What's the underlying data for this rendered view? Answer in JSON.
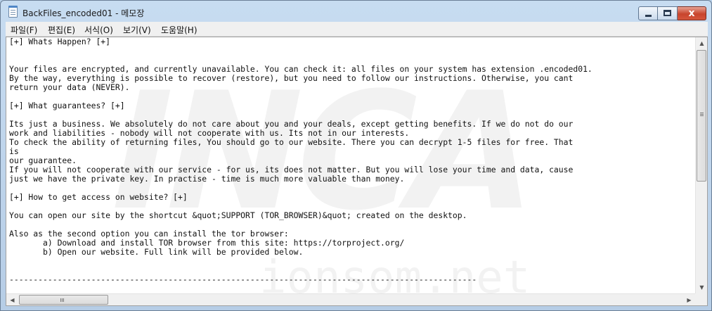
{
  "window": {
    "title": "BackFiles_encoded01 - 메모장",
    "icon": "notepad-icon"
  },
  "controls": {
    "minimize": "minimize-icon",
    "maximize": "maximize-icon",
    "close_glyph": "x"
  },
  "menu": {
    "items": [
      {
        "label": "파일(F)"
      },
      {
        "label": "편집(E)"
      },
      {
        "label": "서식(O)"
      },
      {
        "label": "보기(V)"
      },
      {
        "label": "도움말(H)"
      }
    ]
  },
  "document": {
    "text": "[+] Whats Happen? [+]\n\n\nYour files are encrypted, and currently unavailable. You can check it: all files on your system has extension .encoded01.\nBy the way, everything is possible to recover (restore), but you need to follow our instructions. Otherwise, you cant\nreturn your data (NEVER).\n\n[+] What guarantees? [+]\n\nIts just a business. We absolutely do not care about you and your deals, except getting benefits. If we do not do our\nwork and liabilities - nobody will not cooperate with us. Its not in our interests.\nTo check the ability of returning files, You should go to our website. There you can decrypt 1-5 files for free. That\nis\nour guarantee.\nIf you will not cooperate with our service - for us, its does not matter. But you will lose your time and data, cause\njust we have the private key. In practise - time is much more valuable than money.\n\n[+] How to get access on website? [+]\n\nYou can open our site by the shortcut &quot;SUPPORT (TOR_BROWSER)&quot; created on the desktop.\n\nAlso as the second option you can install the tor browser:\n       a) Download and install TOR browser from this site: https://torproject.org/\n       b) Open our website. Full link will be provided below.\n\n\n-------------------------------------------------------------------------------------------------"
  },
  "scrollbars": {
    "vertical": {
      "up": "▲",
      "down": "▼",
      "position": 0.0
    },
    "horizontal": {
      "left": "◀",
      "right": "▶",
      "position": 0.0
    }
  },
  "watermark": {
    "main": "INCA",
    "sub": "ionsom.net"
  }
}
